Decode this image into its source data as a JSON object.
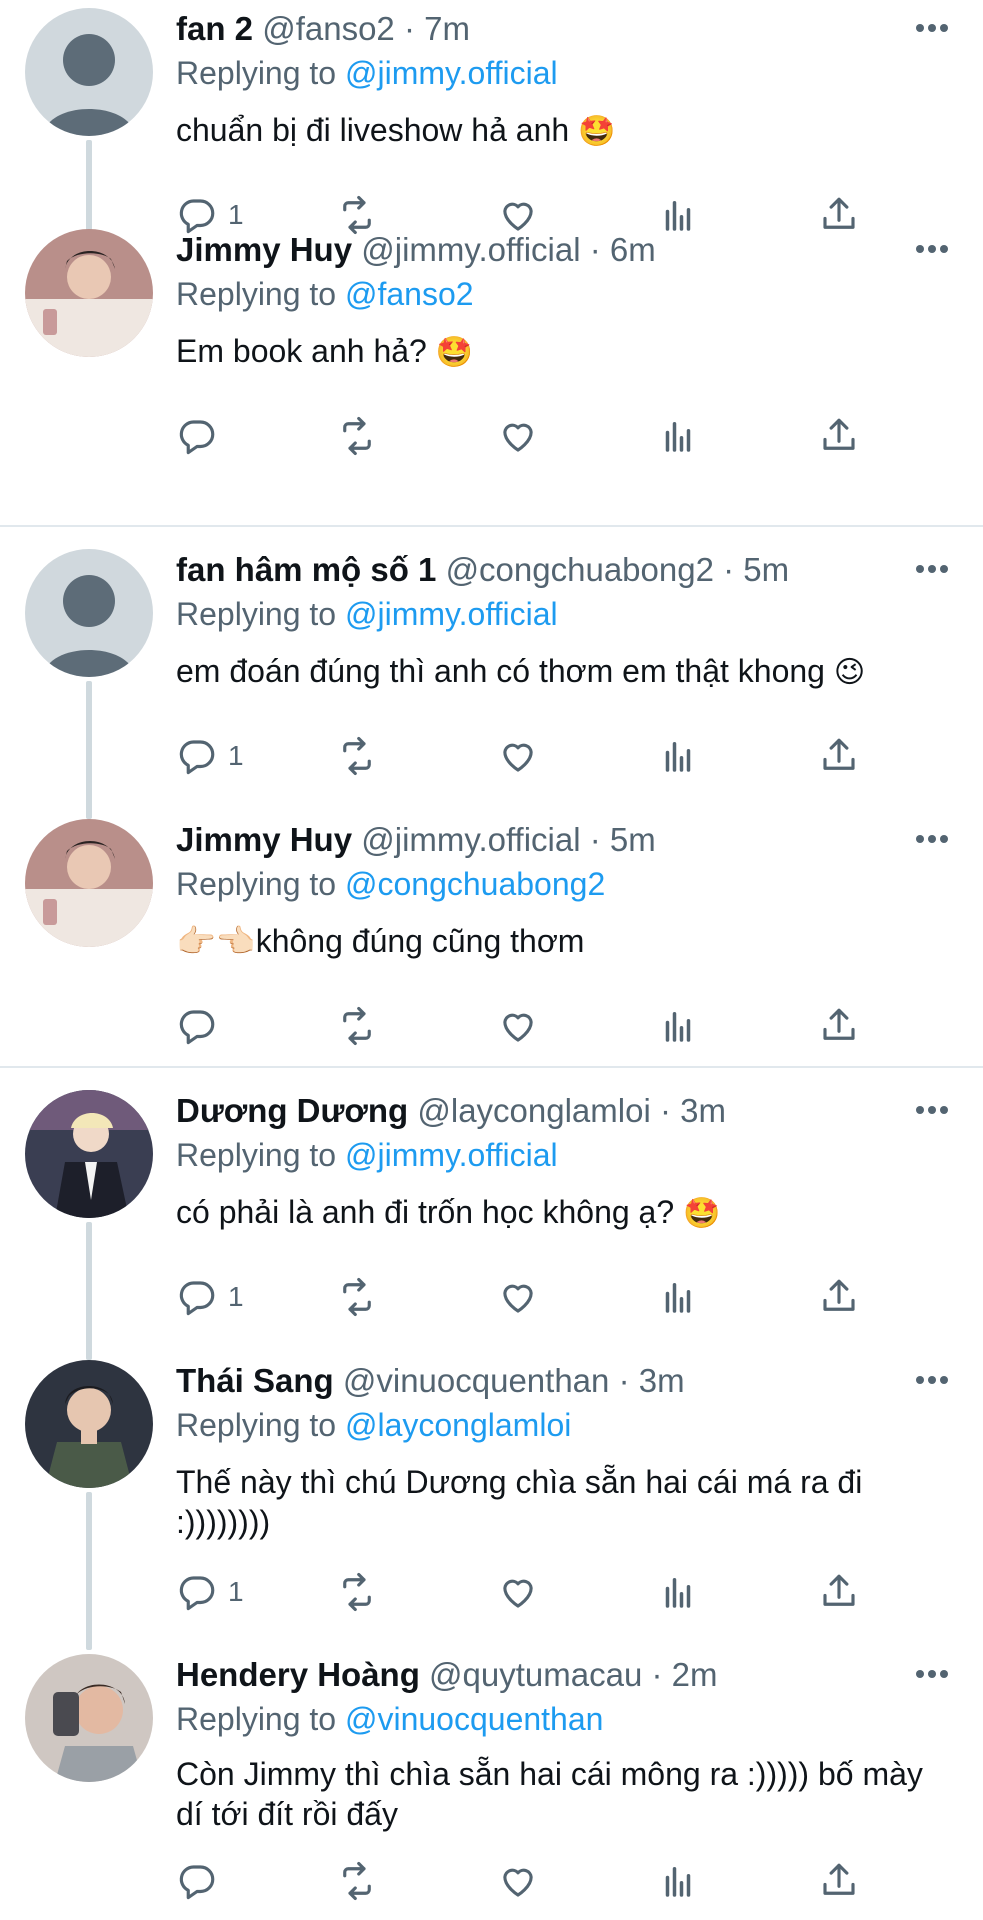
{
  "tweets": [
    {
      "name": "fan 2",
      "handle": "@fanso2",
      "time": "7m",
      "replying_prefix": "Replying to",
      "replying_to": "@jimmy.official",
      "text": "chuẩn bị đi liveshow hả anh",
      "emoji": "🤩",
      "reply_count": "1",
      "avatar": "default-avatar"
    },
    {
      "name": "Jimmy Huy",
      "handle": "@jimmy.official",
      "time": "6m",
      "replying_prefix": "Replying to",
      "replying_to": "@fanso2",
      "text": "Em book anh hả?",
      "emoji": "🤩",
      "reply_count": "",
      "avatar": "photo-avatar"
    },
    {
      "name": "fan hâm mộ số 1",
      "handle": "@congchuabong2",
      "time": "5m",
      "replying_prefix": "Replying to",
      "replying_to": "@jimmy.official",
      "text": "em đoán đúng thì anh có thơm em thật khong",
      "emoji": "😉",
      "reply_count": "1",
      "avatar": "default-avatar"
    },
    {
      "name": "Jimmy Huy",
      "handle": "@jimmy.official",
      "time": "5m",
      "replying_prefix": "Replying to",
      "replying_to": "@congchuabong2",
      "text": "👉🏻👈🏻không đúng cũng thơm",
      "emoji": "",
      "reply_count": "",
      "avatar": "photo-avatar"
    },
    {
      "name": "Dương Dương",
      "handle": "@layconglamloi",
      "time": "3m",
      "replying_prefix": "Replying to",
      "replying_to": "@jimmy.official",
      "text": "có phải là anh đi trốn học không ạ?",
      "emoji": "🤩",
      "reply_count": "1",
      "avatar": "photo-avatar"
    },
    {
      "name": "Thái Sang",
      "handle": "@vinuocquenthan",
      "time": "3m",
      "replying_prefix": "Replying to",
      "replying_to": "@layconglamloi",
      "text": "Thế này thì chú Dương chìa sẵn hai cái má ra đi :))))))))",
      "emoji": "",
      "reply_count": "1",
      "avatar": "photo-avatar"
    },
    {
      "name": "Hendery Hoàng",
      "handle": "@quytumacau",
      "time": "2m",
      "replying_prefix": "Replying to",
      "replying_to": "@vinuocquenthan",
      "text": "Còn Jimmy thì chìa sẵn hai cái mông ra :))))) bố mày dí tới đít rồi đấy",
      "emoji": "",
      "reply_count": "",
      "avatar": "photo-avatar"
    }
  ],
  "colors": {
    "text": "#0f1419",
    "secondary": "#536471",
    "link": "#1d9bf0",
    "thread_line": "#cfd9de",
    "divider": "#e1e8ed"
  },
  "icons": {
    "more": "more-dots-icon",
    "reply": "reply-icon",
    "retweet": "retweet-icon",
    "like": "like-icon",
    "stats": "stats-icon",
    "share": "share-icon"
  }
}
